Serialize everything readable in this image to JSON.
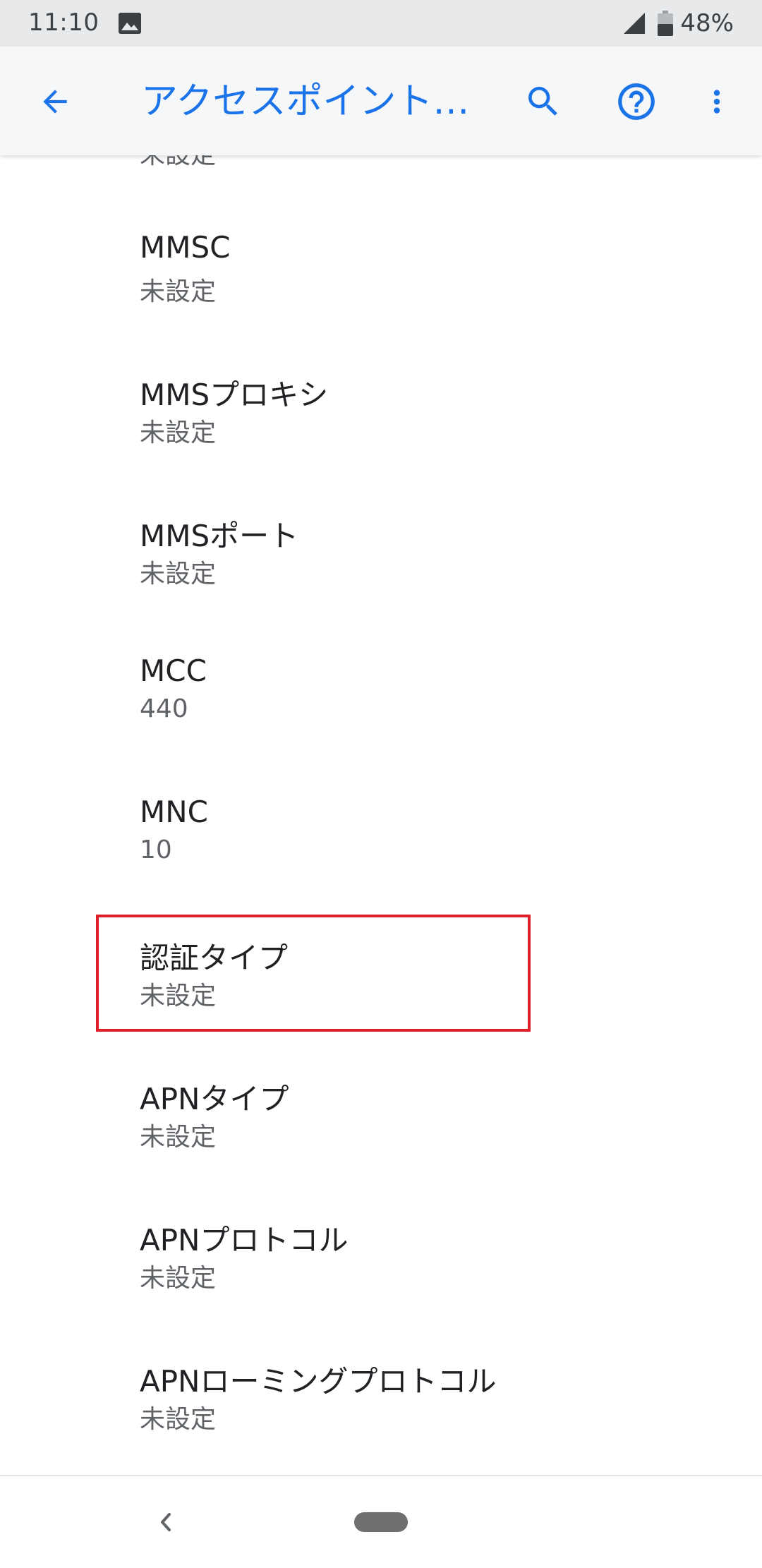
{
  "status_bar": {
    "time": "11:10",
    "image_icon": "image-icon",
    "signal_icon": "cell-signal-icon",
    "battery_icon": "battery-icon",
    "battery": "48%"
  },
  "app_bar": {
    "back_icon": "arrow-back-icon",
    "title": "アクセスポイント…",
    "search_icon": "search-icon",
    "help_icon": "help-icon",
    "more_icon": "more-vert-icon",
    "accent_color": "#1a73e8"
  },
  "list": {
    "partial_top_summary": "未設定",
    "items": [
      {
        "title": "MMSC",
        "summary": "未設定"
      },
      {
        "title": "MMSプロキシ",
        "summary": "未設定"
      },
      {
        "title": "MMSポート",
        "summary": "未設定"
      },
      {
        "title": "MCC",
        "summary": "440"
      },
      {
        "title": "MNC",
        "summary": "10"
      },
      {
        "title": "認証タイプ",
        "summary": "未設定"
      },
      {
        "title": "APNタイプ",
        "summary": "未設定"
      },
      {
        "title": "APNプロトコル",
        "summary": "未設定"
      },
      {
        "title": "APNローミングプロトコル",
        "summary": "未設定"
      }
    ],
    "highlight_color": "#e01e28"
  },
  "nav_bar": {
    "back_icon": "nav-back-icon",
    "home_icon": "nav-home-pill-icon"
  }
}
